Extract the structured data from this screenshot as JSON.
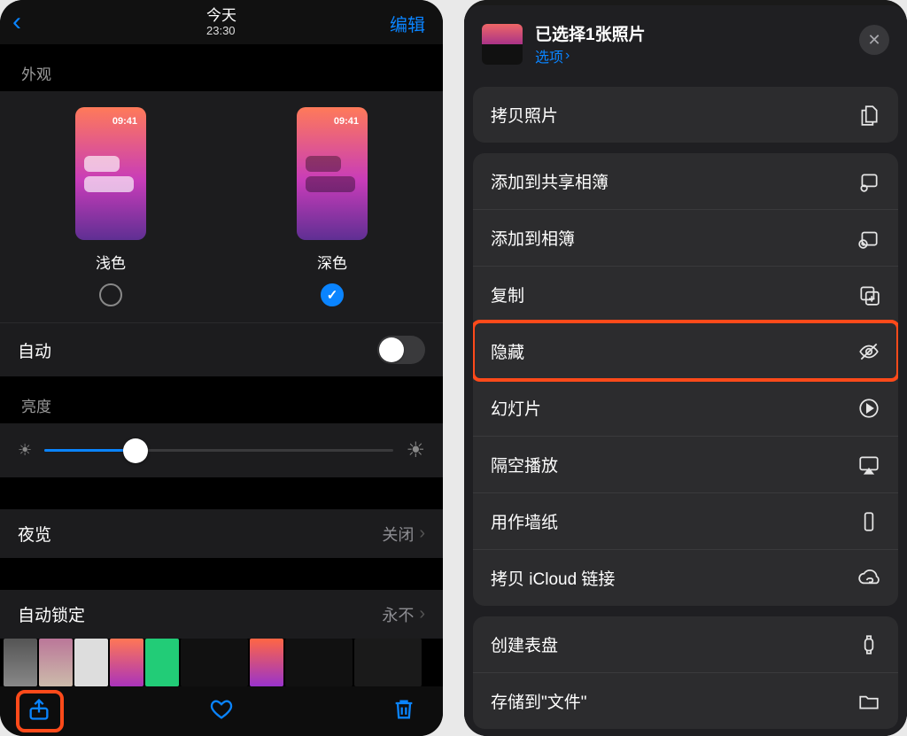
{
  "left": {
    "nav": {
      "title": "今天",
      "time": "23:30",
      "edit": "编辑"
    },
    "appearance": {
      "heading": "外观",
      "light": "浅色",
      "dark": "深色",
      "selected": "dark",
      "auto_label": "自动",
      "auto_on": false
    },
    "brightness": {
      "heading": "亮度",
      "value_pct": 26
    },
    "night_shift": {
      "label": "夜览",
      "value": "关闭"
    },
    "auto_lock": {
      "label": "自动锁定",
      "value": "永不"
    }
  },
  "right": {
    "header": {
      "title": "已选择1张照片",
      "options": "选项"
    },
    "groups": [
      [
        {
          "id": "copy-photo",
          "label": "拷贝照片",
          "icon": "copy-doc"
        }
      ],
      [
        {
          "id": "add-shared",
          "label": "添加到共享相簿",
          "icon": "shared-album"
        },
        {
          "id": "add-album",
          "label": "添加到相簿",
          "icon": "album-add"
        },
        {
          "id": "duplicate",
          "label": "复制",
          "icon": "duplicate"
        },
        {
          "id": "hide",
          "label": "隐藏",
          "icon": "eye-off",
          "highlighted": true
        },
        {
          "id": "slideshow",
          "label": "幻灯片",
          "icon": "play-circle"
        },
        {
          "id": "airplay",
          "label": "隔空播放",
          "icon": "airplay"
        },
        {
          "id": "wallpaper",
          "label": "用作墙纸",
          "icon": "phone-rect"
        },
        {
          "id": "icloud-link",
          "label": "拷贝 iCloud 链接",
          "icon": "cloud-link"
        }
      ],
      [
        {
          "id": "watch-face",
          "label": "创建表盘",
          "icon": "watch"
        },
        {
          "id": "save-files",
          "label": "存储到\"文件\"",
          "icon": "folder"
        }
      ]
    ]
  }
}
